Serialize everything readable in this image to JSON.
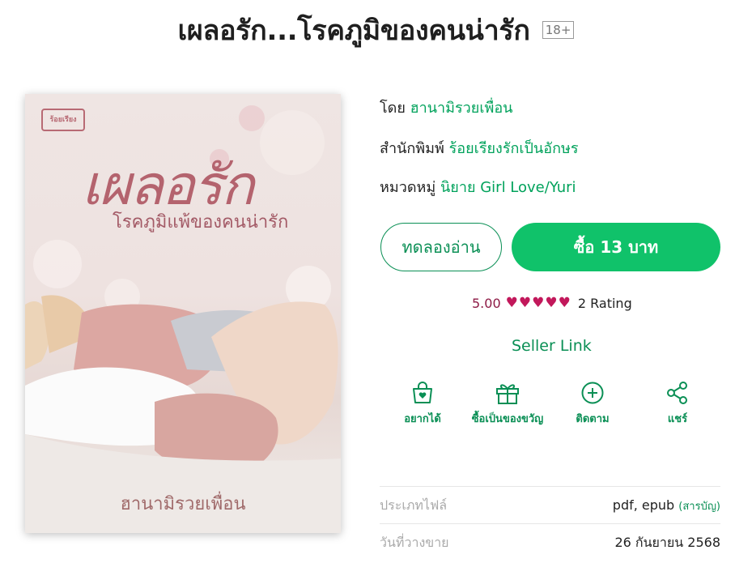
{
  "book": {
    "title": "เผลอรัก...โรคภูมิของคนน่ารัก",
    "age_rating": "18+",
    "author_label": "โดย",
    "author": "ฮานามิรวยเพื่อน",
    "publisher_label": "สำนักพิมพ์",
    "publisher": "ร้อยเรียงรักเป็นอักษร",
    "category_label": "หมวดหมู่",
    "category": "นิยาย Girl Love/Yuri"
  },
  "cover": {
    "logo_text": "ร้อยเรียง",
    "title_text": "เผลอรัก",
    "subtitle_text": "โรคภูมิแพ้ของคนน่ารัก",
    "author_text": "ฮานามิรวยเพื่อน"
  },
  "buttons": {
    "trial": "ทดลองอ่าน",
    "buy": "ซื้อ 13 บาท"
  },
  "rating": {
    "value": "5.00",
    "hearts": 5,
    "count": "2 Rating",
    "heart_color": "#c2185b"
  },
  "seller_link": "Seller Link",
  "actions": [
    {
      "label": "อยากได้",
      "icon": "bag-heart-icon"
    },
    {
      "label": "ซื้อเป็นของขวัญ",
      "icon": "gift-icon"
    },
    {
      "label": "ติดตาม",
      "icon": "plus-circle-icon"
    },
    {
      "label": "แชร์",
      "icon": "share-icon"
    }
  ],
  "details": [
    {
      "key": "ประเภทไฟล์",
      "value": "pdf, epub",
      "note": "(สารบัญ)"
    },
    {
      "key": "วันที่วางขาย",
      "value": "26 กันยายน 2568",
      "note": ""
    }
  ],
  "colors": {
    "accent": "#10c26a",
    "link": "#0a8f55"
  }
}
